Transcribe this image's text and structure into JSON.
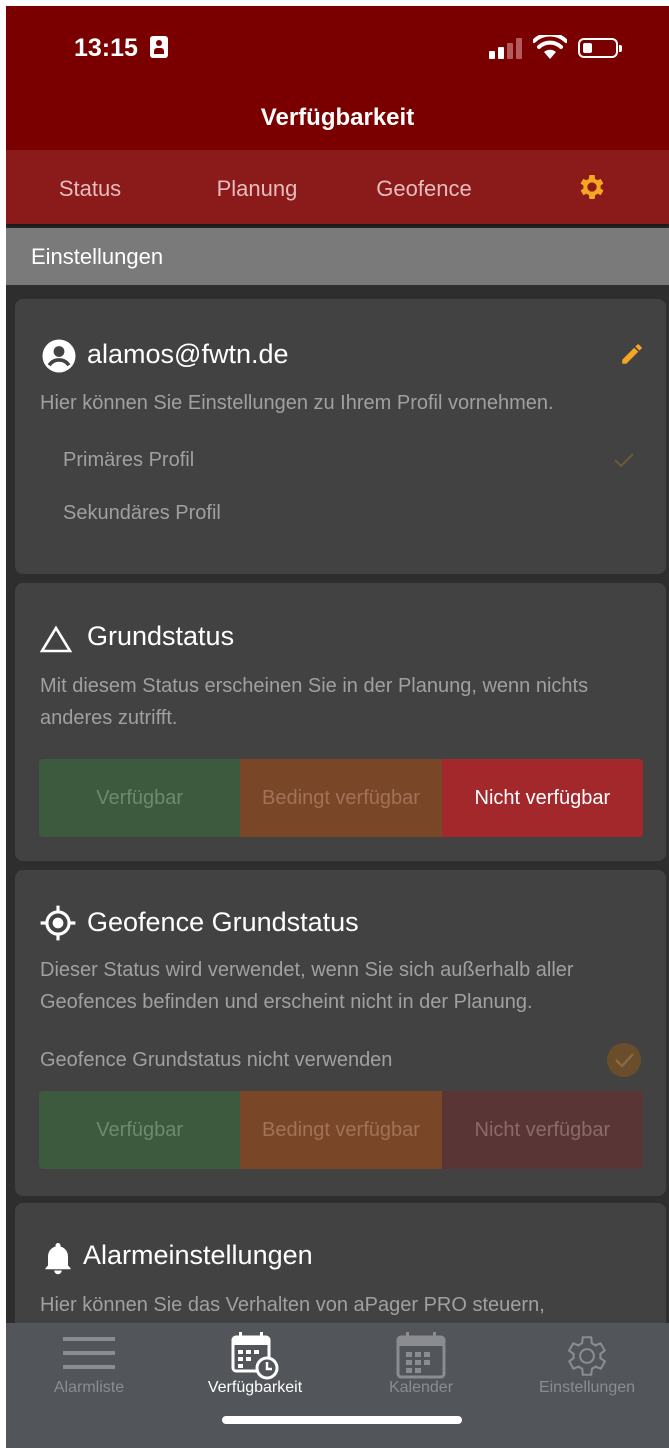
{
  "status_bar": {
    "time": "13:15"
  },
  "app_bar": {
    "title": "Verfügbarkeit"
  },
  "tabs": [
    {
      "label": "Status"
    },
    {
      "label": "Planung"
    },
    {
      "label": "Geofence"
    }
  ],
  "section_header": "Einstellungen",
  "profile_card": {
    "email": "alamos@fwtn.de",
    "description": "Hier können Sie Einstellungen zu Ihrem Profil vornehmen.",
    "primary_label": "Primäres Profil",
    "secondary_label": "Sekundäres Profil"
  },
  "base_status_card": {
    "title": "Grundstatus",
    "description": "Mit diesem Status erscheinen Sie in der Planung, wenn nichts anderes zutrifft.",
    "options": [
      "Verfügbar",
      "Bedingt verfügbar",
      "Nicht verfügbar"
    ],
    "selected": "Nicht verfügbar"
  },
  "geofence_card": {
    "title": "Geofence Grundstatus",
    "description": "Dieser Status wird verwendet, wenn Sie sich außerhalb aller Geofences befinden und erscheint nicht in der Planung.",
    "toggle_label": "Geofence Grundstatus nicht verwenden",
    "options": [
      "Verfügbar",
      "Bedingt verfügbar",
      "Nicht verfügbar"
    ]
  },
  "alarm_card": {
    "title": "Alarmeinstellungen",
    "description": "Hier können Sie das Verhalten von aPager PRO steuern,"
  },
  "bottom_nav": [
    {
      "label": "Alarmliste",
      "icon": "list-icon"
    },
    {
      "label": "Verfügbarkeit",
      "icon": "calendar-clock-icon",
      "active": true
    },
    {
      "label": "Kalender",
      "icon": "calendar-icon"
    },
    {
      "label": "Einstellungen",
      "icon": "gear-icon"
    }
  ],
  "colors": {
    "primary_red": "#7a0000",
    "accent_orange": "#f5a623",
    "available_green": "#3d5a3e",
    "conditional_orange": "#7a4628",
    "unavailable_red": "#a3282c"
  }
}
